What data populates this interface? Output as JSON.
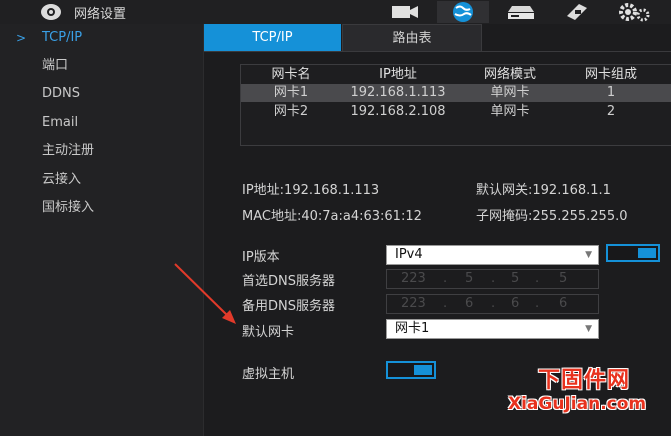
{
  "header": {
    "title": "网络设置",
    "icons": [
      "settings-logo-icon",
      "camera-icon",
      "network-globe-icon",
      "storage-icon",
      "system-icon",
      "tools-gear-icon"
    ]
  },
  "sidebar": {
    "items": [
      {
        "label": "TCP/IP",
        "active": true
      },
      {
        "label": "端口"
      },
      {
        "label": "DDNS"
      },
      {
        "label": "Email"
      },
      {
        "label": "主动注册"
      },
      {
        "label": "云接入"
      },
      {
        "label": "国标接入"
      }
    ]
  },
  "tabs": [
    {
      "label": "TCP/IP",
      "active": true
    },
    {
      "label": "路由表"
    }
  ],
  "nic_table": {
    "headers": [
      "网卡名",
      "IP地址",
      "网络模式",
      "网卡组成"
    ],
    "rows": [
      [
        "网卡1",
        "192.168.1.113",
        "单网卡",
        "1"
      ],
      [
        "网卡2",
        "192.168.2.108",
        "单网卡",
        "2"
      ]
    ]
  },
  "info": {
    "ip": "IP地址:192.168.1.113",
    "gateway": "默认网关:192.168.1.1",
    "mac": "MAC地址:40:7a:a4:63:61:12",
    "mask": "子网掩码:255.255.255.0"
  },
  "form": {
    "ip_version_label": "IP版本",
    "ip_version_value": "IPv4",
    "dns1_label": "首选DNS服务器",
    "dns1": [
      "223",
      ".",
      "5",
      ".",
      "5",
      ".",
      "5"
    ],
    "dns2_label": "备用DNS服务器",
    "dns2": [
      "223",
      ".",
      "6",
      ".",
      "6",
      ".",
      "6"
    ],
    "default_nic_label": "默认网卡",
    "default_nic_value": "网卡1",
    "virtual_host_label": "虚拟主机"
  },
  "watermark": {
    "line1": "下固件网",
    "line2": "XiaGuJian.com"
  },
  "colors": {
    "accent": "#1591d8",
    "arrow": "#e23a2a",
    "watermark": "#e8321e"
  }
}
